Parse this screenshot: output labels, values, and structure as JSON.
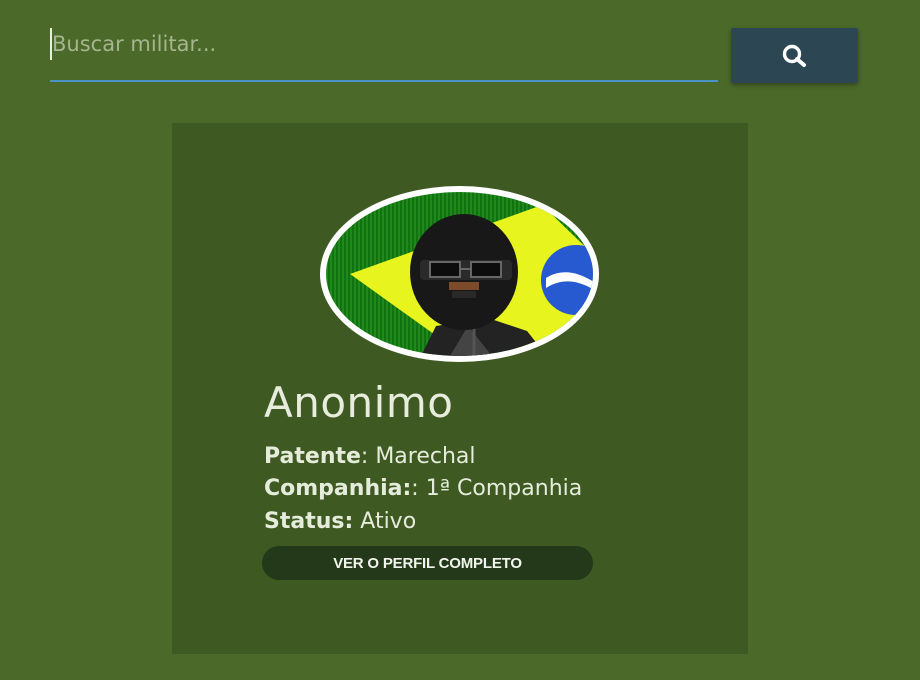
{
  "search": {
    "placeholder": "Buscar militar...",
    "value": "",
    "button_icon": "search-icon"
  },
  "profile": {
    "avatar_icon": "military-avatar-icon",
    "name": "Anonimo",
    "patente_label": "Patente",
    "patente_value": ": Marechal",
    "companhia_label": "Companhia:",
    "companhia_value": ": 1ª Companhia",
    "status_label": "Status:",
    "status_value": " Ativo",
    "button_label": "VER O PERFIL COMPLETO"
  },
  "colors": {
    "background": "#4b6a29",
    "card": "#3e5a22",
    "search_underline": "#4a93c9",
    "search_button": "#2d4654",
    "profile_button": "#24381a"
  }
}
